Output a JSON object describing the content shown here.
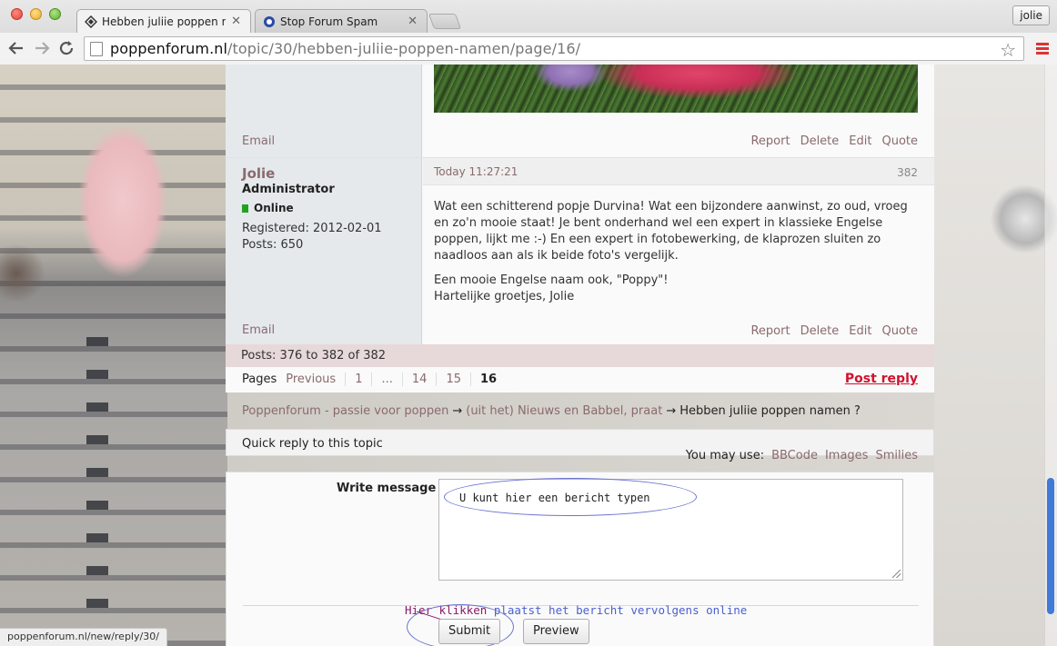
{
  "browser": {
    "tabs": [
      {
        "title": "Hebben juliie poppen nam",
        "active": true
      },
      {
        "title": "Stop Forum Spam",
        "active": false
      }
    ],
    "profile_name": "jolie",
    "url_host": "poppenforum.nl",
    "url_path": "/topic/30/hebben-juliie-poppen-namen/page/16/",
    "status_url": "poppenforum.nl/new/reply/30/"
  },
  "post_actions": [
    "Report",
    "Delete",
    "Edit",
    "Quote"
  ],
  "post1": {
    "email": "Email"
  },
  "post2": {
    "username": "Jolie",
    "title": "Administrator",
    "status": "Online",
    "registered": "Registered: 2012-02-01",
    "posts": "Posts: 650",
    "time": "Today 11:27:21",
    "number": "382",
    "paragraph1": "Wat een schitterend popje Durvina! Wat een bijzondere aanwinst, zo oud, vroeg en zo'n mooie staat! Je bent onderhand wel een expert in klassieke Engelse poppen, lijkt me :-) En een expert in fotobewerking, de klaprozen sluiten zo naadloos aan als ik beide foto's vergelijk.",
    "paragraph2_line1": "Een mooie Engelse naam ook, \"Poppy\"!",
    "paragraph2_line2": "Hartelijke groetjes, Jolie",
    "email": "Email"
  },
  "post_count": "Posts: 376 to 382 of 382",
  "pagination": {
    "label": "Pages",
    "previous": "Previous",
    "pages": [
      "1",
      "...",
      "14",
      "15"
    ],
    "current": "16",
    "post_reply": "Post reply"
  },
  "breadcrumb": {
    "root": "Poppenforum - passie voor poppen",
    "section": "(uit het) Nieuws en Babbel, praat",
    "current": "Hebben juliie poppen namen ?",
    "separator": "→"
  },
  "quick_reply": {
    "title": "Quick reply to this topic",
    "you_may_use": "You may use:",
    "links": [
      "BBCode",
      "Images",
      "Smilies"
    ],
    "write_label": "Write message",
    "textarea_hint": "U kunt hier een bericht typen",
    "hint_emph": "Hier klikken",
    "hint_rest": " plaatst het bericht vervolgens online",
    "submit": "Submit",
    "preview": "Preview"
  },
  "colors": {
    "link": "#8a6a6e",
    "post_reply": "#d1122e",
    "online_dot": "#1fa31f",
    "annotation": "#4a5fd0"
  }
}
